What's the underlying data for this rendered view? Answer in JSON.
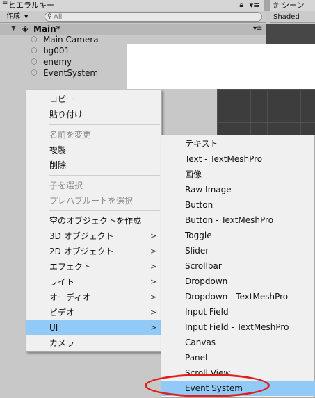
{
  "tabs": {
    "hierarchy": "ヒエラルキー",
    "scene": "シーン"
  },
  "toolbar": {
    "create_label": "作成",
    "search_placeholder": "All",
    "shaded_label": "Shaded"
  },
  "scene": {
    "name": "Main*",
    "objects": [
      "Main Camera",
      "bg001",
      "enemy",
      "EventSystem"
    ]
  },
  "context_menu": {
    "items": [
      {
        "label": "コピー",
        "enabled": true
      },
      {
        "label": "貼り付け",
        "enabled": true
      },
      {
        "label": "名前を変更",
        "enabled": false
      },
      {
        "label": "複製",
        "enabled": true
      },
      {
        "label": "削除",
        "enabled": true
      },
      {
        "label": "子を選択",
        "enabled": false
      },
      {
        "label": "プレハブルートを選択",
        "enabled": false
      },
      {
        "label": "空のオブジェクトを作成",
        "enabled": true
      },
      {
        "label": "3D オブジェクト",
        "enabled": true,
        "submenu": true
      },
      {
        "label": "2D オブジェクト",
        "enabled": true,
        "submenu": true
      },
      {
        "label": "エフェクト",
        "enabled": true,
        "submenu": true
      },
      {
        "label": "ライト",
        "enabled": true,
        "submenu": true
      },
      {
        "label": "オーディオ",
        "enabled": true,
        "submenu": true
      },
      {
        "label": "ビデオ",
        "enabled": true,
        "submenu": true
      },
      {
        "label": "UI",
        "enabled": true,
        "submenu": true,
        "selected": true
      },
      {
        "label": "カメラ",
        "enabled": true
      }
    ]
  },
  "ui_submenu": {
    "items": [
      "テキスト",
      "Text - TextMeshPro",
      "画像",
      "Raw Image",
      "Button",
      "Button - TextMeshPro",
      "Toggle",
      "Slider",
      "Scrollbar",
      "Dropdown",
      "Dropdown - TextMeshPro",
      "Input Field",
      "Input Field - TextMeshPro",
      "Canvas",
      "Panel",
      "Scroll View",
      "Event System"
    ],
    "selected": "Event System"
  },
  "highlight_color": "#e0201a"
}
